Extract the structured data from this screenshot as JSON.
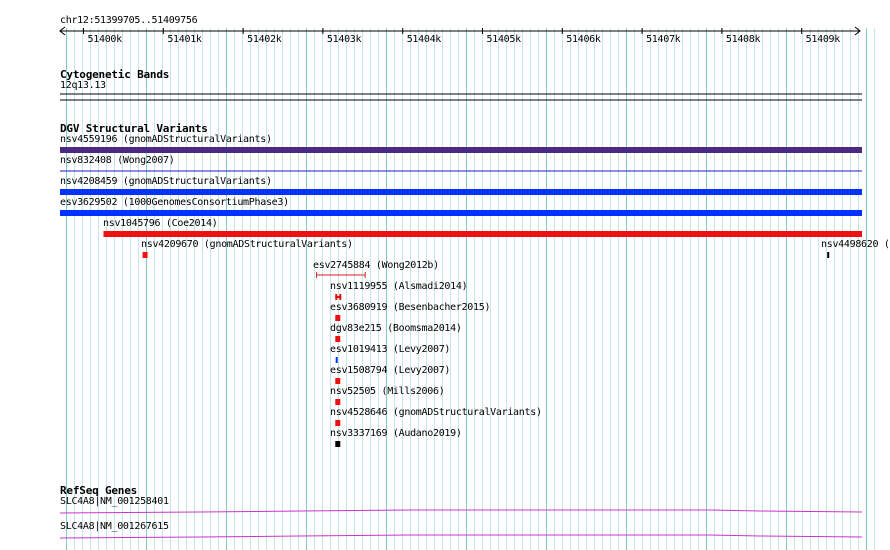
{
  "region": "chr12:51399705..51409756",
  "ruler": {
    "start": 51399705,
    "end": 51409756,
    "ticks": [
      "51400k",
      "51401k",
      "51402k",
      "51403k",
      "51404k",
      "51405k",
      "51406k",
      "51407k",
      "51408k",
      "51409k"
    ]
  },
  "tracks": {
    "cytoband": {
      "title": "Cytogenetic Bands",
      "band": "12q13.13"
    },
    "dgv": {
      "title": "DGV Structural Variants",
      "features": [
        {
          "label": "nsv4559196 (gnomADStructuralVariants)",
          "color": "#4b2882",
          "start": 51399705,
          "end": 51409756
        },
        {
          "label": "nsv832408 (Wong2007)",
          "color": "#1a1acc",
          "start": 51399705,
          "end": 51409756
        },
        {
          "label": "nsv4208459 (gnomADStructuralVariants)",
          "color": "#0033ff",
          "start": 51399705,
          "end": 51409756
        },
        {
          "label": "esv3629502 (1000GenomesConsortiumPhase3)",
          "color": "#0033ff",
          "start": 51399705,
          "end": 51409756
        },
        {
          "label": "nsv1045796 (Coe2014)",
          "color": "#ee1111",
          "start": 51400250,
          "end": 51409756
        },
        {
          "label": "nsv4209670 (gnomADStructuralVariants)",
          "color": "#ee1111",
          "start": 51400740,
          "end": 51400800
        },
        {
          "label": "nsv4498620 (",
          "color": "#000000",
          "start": 51409320,
          "end": 51409340
        },
        {
          "label": "esv2745884 (Wong2012b)",
          "color": "#dd2222",
          "start": 51402920,
          "end": 51403530
        },
        {
          "label": "nsv1119955 (Alsmadi2014)",
          "color": "#dd1111",
          "start": 51403155,
          "end": 51403215
        },
        {
          "label": "esv3680919 (Besenbacher2015)",
          "color": "#ee1111",
          "start": 51403155,
          "end": 51403210
        },
        {
          "label": "dgv83e215 (Boomsma2014)",
          "color": "#ee1111",
          "start": 51403155,
          "end": 51403210
        },
        {
          "label": "esv1019413 (Levy2007)",
          "color": "#0033ff",
          "start": 51403160,
          "end": 51403185
        },
        {
          "label": "esv1508794 (Levy2007)",
          "color": "#ee1111",
          "start": 51403155,
          "end": 51403210
        },
        {
          "label": "nsv52505 (Mills2006)",
          "color": "#ee1111",
          "start": 51403155,
          "end": 51403210
        },
        {
          "label": "nsv4528646 (gnomADStructuralVariants)",
          "color": "#ee1111",
          "start": 51403155,
          "end": 51403210
        },
        {
          "label": "nsv3337169 (Audano2019)",
          "color": "#000000",
          "start": 51403155,
          "end": 51403210
        }
      ]
    },
    "refseq": {
      "title": "RefSeq Genes",
      "transcripts": [
        {
          "label": "SLC4A8|NM_001258401",
          "color": "#cc33cc"
        },
        {
          "label": "SLC4A8|NM_001267615",
          "color": "#cc33cc"
        }
      ]
    }
  }
}
